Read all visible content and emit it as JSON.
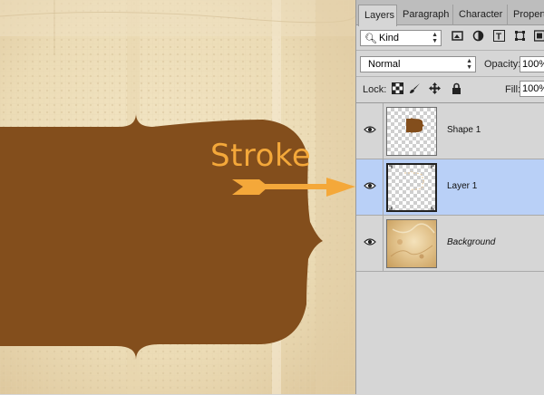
{
  "canvas": {
    "annotation_label": "Stroke",
    "shape_color": "#834e1c",
    "annotation_color": "#f4a83a"
  },
  "panel": {
    "tabs": [
      "Layers",
      "Paragraph",
      "Character",
      "Propert"
    ],
    "active_tab": "Layers",
    "filter": {
      "kind_value": "Kind",
      "icons": [
        "image-filter-icon",
        "adjustment-filter-icon",
        "type-filter-icon",
        "shape-filter-icon",
        "smart-object-filter-icon"
      ]
    },
    "blend_mode": "Normal",
    "opacity_label": "Opacity:",
    "opacity_value": "100%",
    "lock_label": "Lock:",
    "lock_icons": [
      "lock-transparent-icon",
      "lock-image-icon",
      "lock-position-icon",
      "lock-all-icon"
    ],
    "fill_label": "Fill:",
    "fill_value": "100%",
    "layers": [
      {
        "name": "Shape 1",
        "selected": false,
        "visible": true
      },
      {
        "name": "Layer 1",
        "selected": true,
        "visible": true
      },
      {
        "name": "Background",
        "selected": false,
        "visible": true,
        "italic": true
      }
    ],
    "selection_color": "#b9d0f7"
  }
}
